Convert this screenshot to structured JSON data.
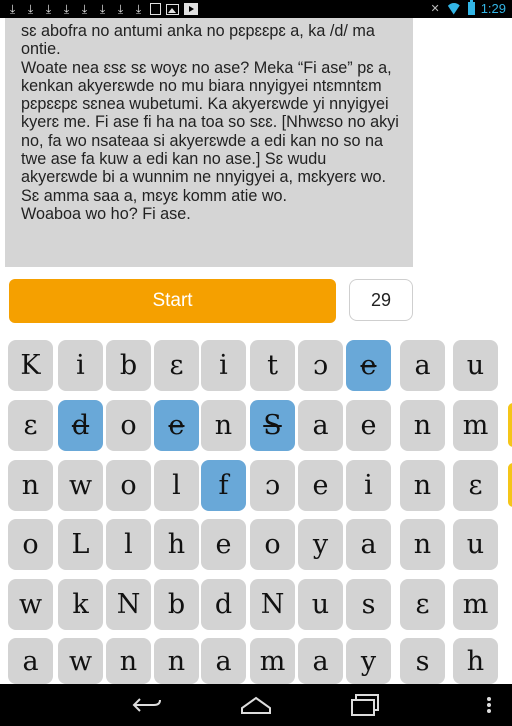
{
  "status_bar": {
    "time": "1:29",
    "left_icons": [
      "download-icon",
      "download-icon",
      "download-icon",
      "download-icon",
      "download-icon",
      "download-icon",
      "download-icon",
      "download-icon",
      "sim-card-icon",
      "image-icon",
      "film-icon"
    ],
    "right_icons": [
      "mute-icon",
      "wifi-icon",
      "battery-icon"
    ],
    "accent_color": "#33b5e5"
  },
  "story_text": "sɛ abofra no antumi anka no pɛpɛɛpɛ a, ka /d/ ma ontie.\nWoate nea ɛsɛ sɛ woyɛ no ase? Meka “Fi ase” pɛ a, kenkan akyerɛwde no mu biara nnyigyei ntɛmntɛm pɛpɛɛpɛ sɛnea wubetumi. Ka akyerɛwde yi nnyigyei kyerɛ me. Fi ase fi ha na toa so sɛɛ. [Nhwɛso no akyi no, fa wo nsateaa si akyerɛwde a edi kan no so na twe ase fa kuw a edi kan no ase.] Sɛ wudu akyerɛwde bi a wunnim ne nnyigyei a, mɛkyerɛ wo. Sɛ amma saa a, mɛyɛ komm atie wo.\nWoaboa wo ho? Fi ase.",
  "start_button_label": "Start",
  "counter_value": "29",
  "start_color": "#f5a000",
  "selected_color": "#69a8d8",
  "tile_rows": [
    [
      "K",
      "i",
      "b",
      "ɛ",
      "i",
      "t",
      "ɔ",
      "e",
      "a",
      "u"
    ],
    [
      "ɛ",
      "d",
      "o",
      "e",
      "n",
      "S",
      "a",
      "e",
      "n",
      "m"
    ],
    [
      "n",
      "w",
      "o",
      "l",
      "f",
      "ɔ",
      "e",
      "i",
      "n",
      "ɛ"
    ],
    [
      "o",
      "L",
      "l",
      "h",
      "e",
      "o",
      "y",
      "a",
      "n",
      "u"
    ],
    [
      "w",
      "k",
      "N",
      "b",
      "d",
      "N",
      "u",
      "s",
      "ɛ",
      "m"
    ],
    [
      "a",
      "w",
      "n",
      "n",
      "a",
      "m",
      "a",
      "y",
      "s",
      "h"
    ]
  ],
  "selected_tiles": [
    [
      0,
      7
    ],
    [
      1,
      1
    ],
    [
      1,
      3
    ],
    [
      1,
      5
    ],
    [
      2,
      4
    ]
  ],
  "struck_tiles": [
    [
      0,
      7
    ],
    [
      1,
      1
    ],
    [
      1,
      3
    ],
    [
      1,
      5
    ]
  ],
  "nav_icons": [
    "back-icon",
    "home-icon",
    "recent-apps-icon",
    "menu-icon"
  ]
}
